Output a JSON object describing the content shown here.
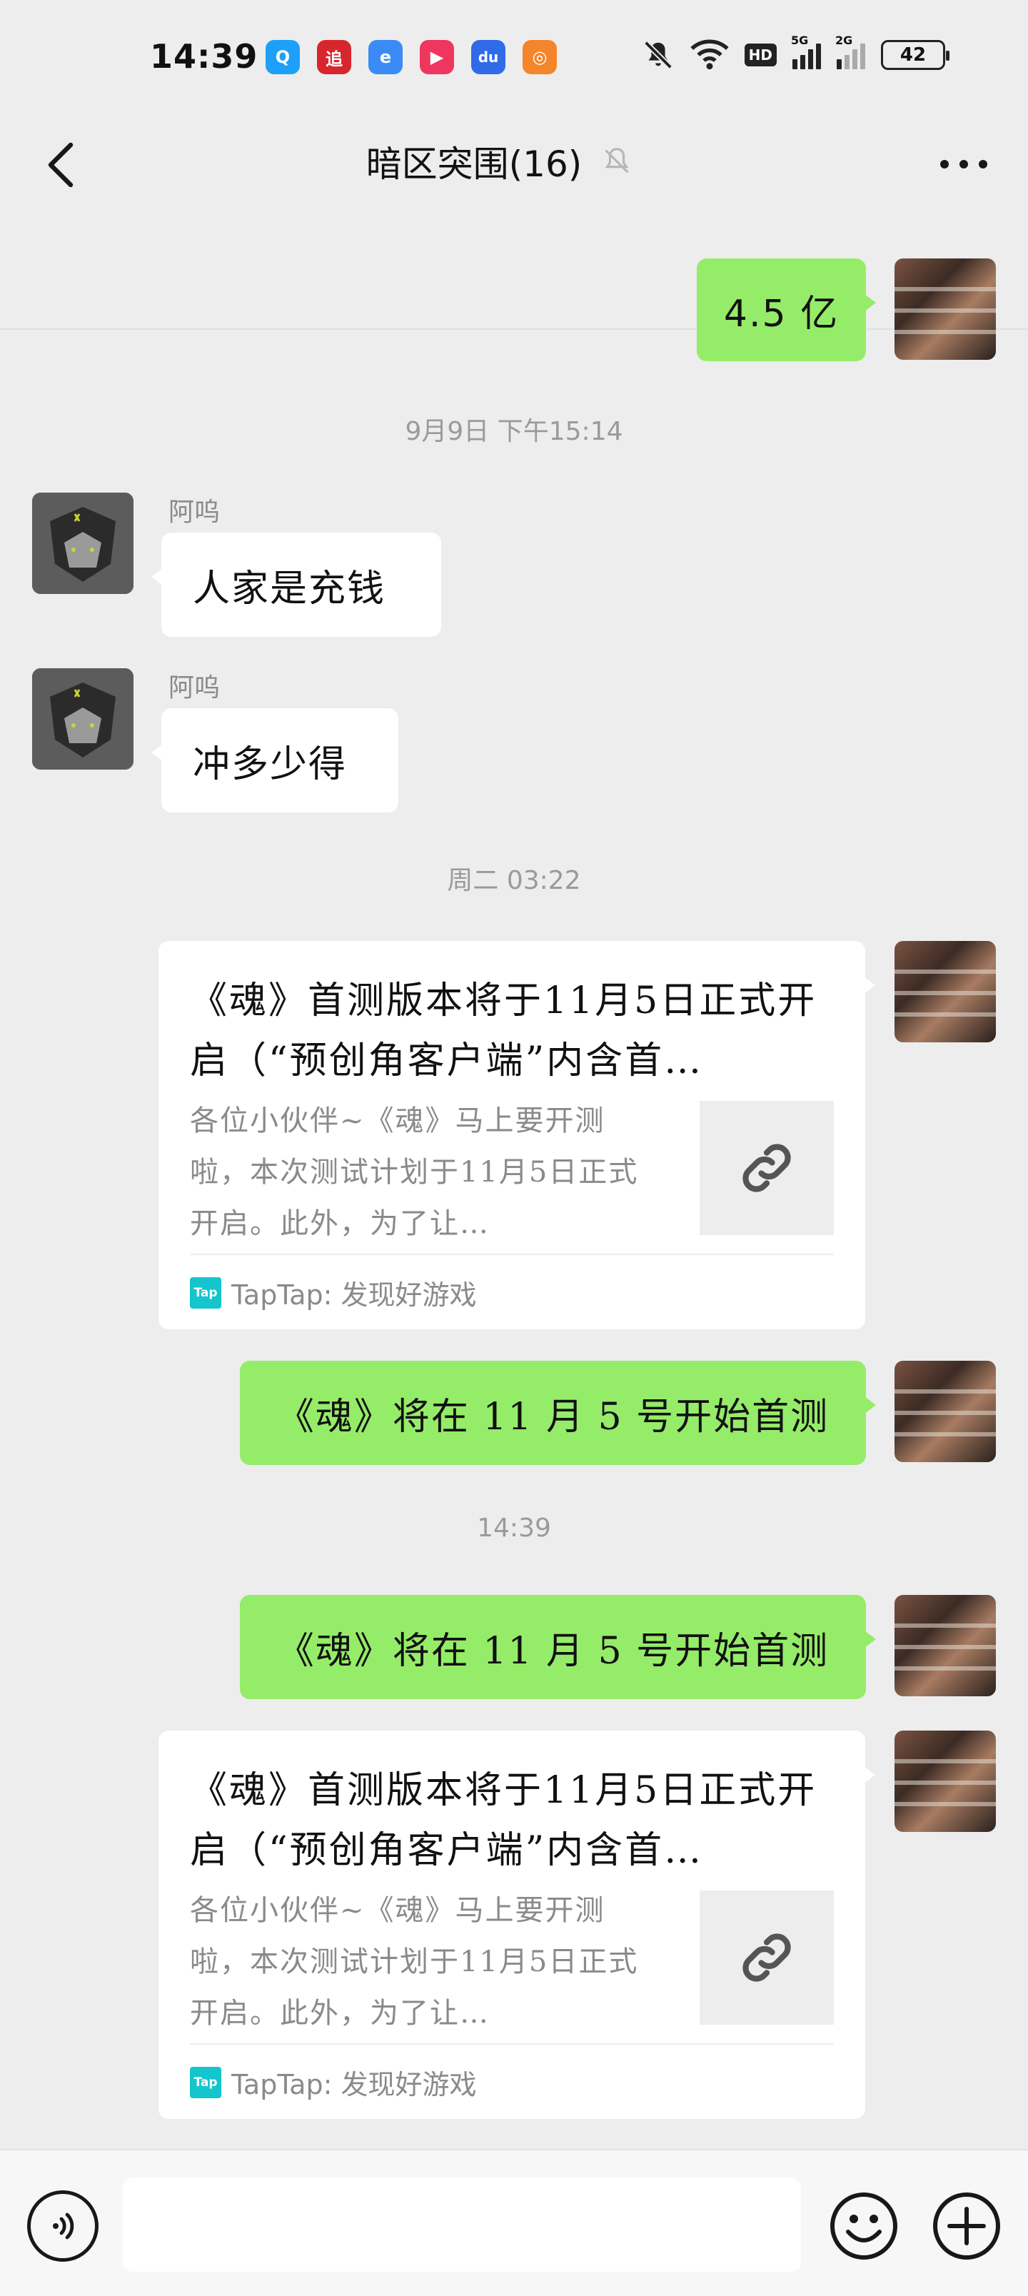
{
  "status_bar": {
    "time": "14:39",
    "apps": [
      {
        "icon": "qq-icon",
        "color": "#1EA0F8",
        "glyph": "Q"
      },
      {
        "icon": "zhui-app-icon",
        "color": "#D8262E",
        "glyph": "追"
      },
      {
        "icon": "browser-icon",
        "color": "#3A8BF5",
        "glyph": "e"
      },
      {
        "icon": "video-app-icon",
        "color": "#F0365E",
        "glyph": "▶"
      },
      {
        "icon": "baidu-icon",
        "color": "#2F6BE8",
        "glyph": "du"
      },
      {
        "icon": "orange-app-icon",
        "color": "#F5852A",
        "glyph": "◎"
      }
    ],
    "hd_label": "HD",
    "signal1_label": "5G",
    "signal2_label": "2G",
    "battery": "42"
  },
  "header": {
    "title": "暗区突围(16)"
  },
  "messages": {
    "m1": {
      "text": "4.5 亿"
    },
    "ts1": "9月9日 下午15:14",
    "m2": {
      "sender": "阿呜",
      "text": "人家是充钱"
    },
    "m3": {
      "sender": "阿呜",
      "text": "冲多少得"
    },
    "ts2": "周二 03:22",
    "card1": {
      "title": "《魂》首测版本将于11月5日正式开启（“预创角客户端”内含首…",
      "desc": "各位小伙伴~《魂》马上要开测啦，本次测试计划于11月5日正式开启。此外，为了让…",
      "source": "TapTap: 发现好游戏",
      "logo": "Tap"
    },
    "m5": {
      "text": "《魂》将在 11 月 5 号开始首测"
    },
    "ts3": "14:39",
    "m6": {
      "text": "《魂》将在 11 月 5 号开始首测"
    },
    "card2": {
      "title": "《魂》首测版本将于11月5日正式开启（“预创角客户端”内含首…",
      "desc": "各位小伙伴~《魂》马上要开测啦，本次测试计划于11月5日正式开启。此外，为了让…",
      "source": "TapTap: 发现好游戏",
      "logo": "Tap"
    }
  },
  "input_bar": {
    "placeholder": ""
  },
  "colors": {
    "background": "#EDEDED",
    "my_bubble": "#95EC69",
    "other_bubble": "#FFFFFF",
    "meta_text": "#9A9A9A"
  }
}
